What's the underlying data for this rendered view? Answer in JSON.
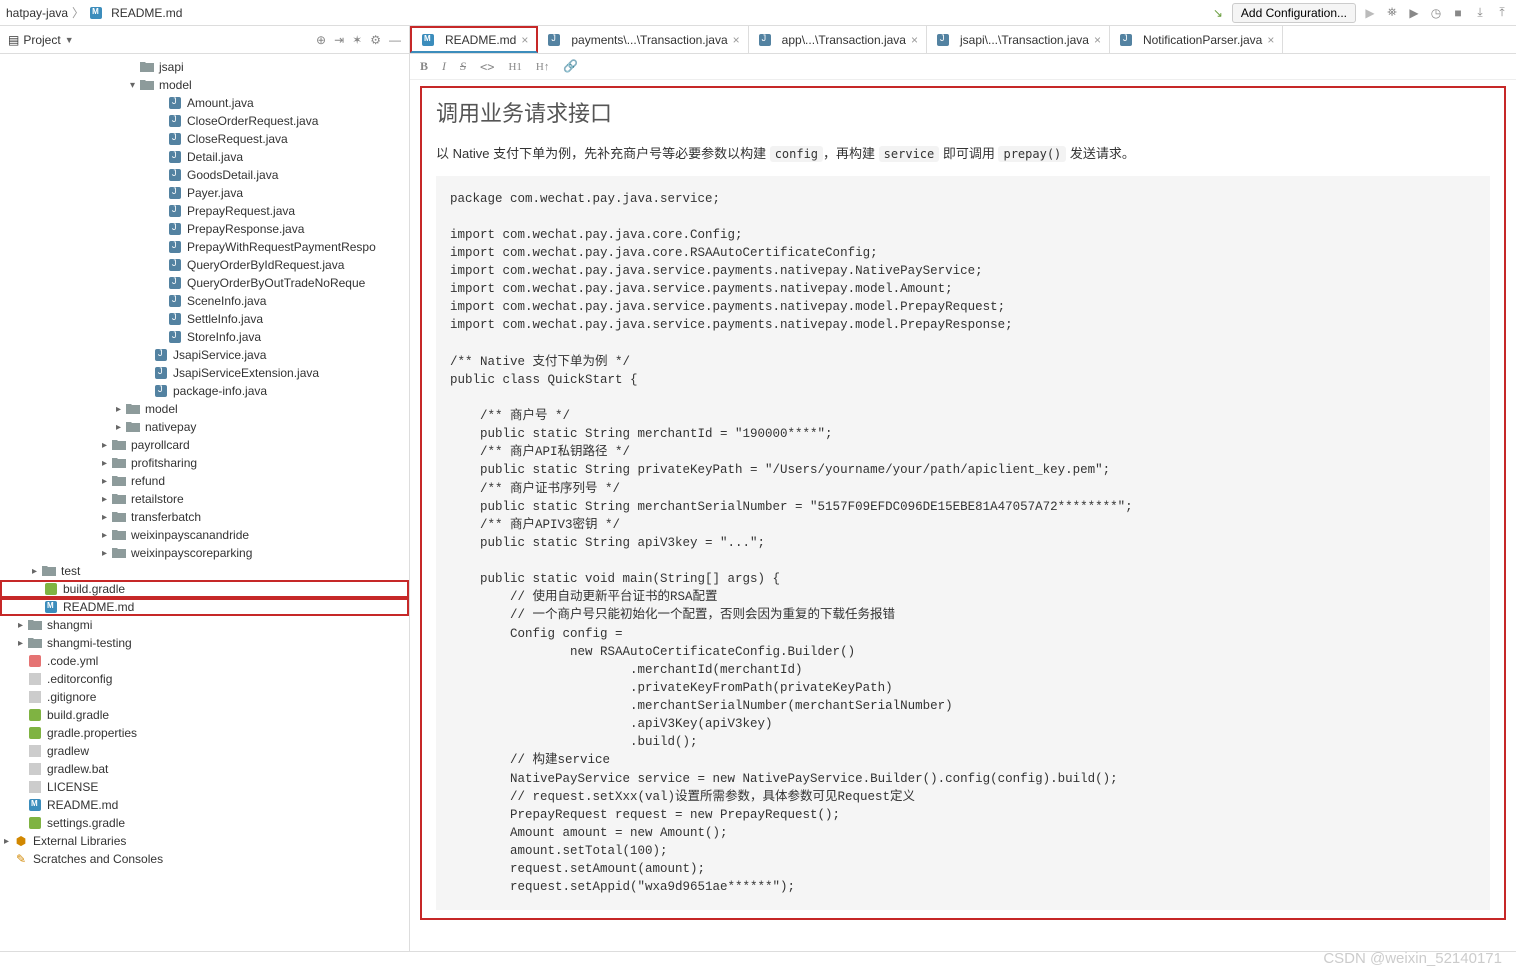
{
  "breadcrumb": {
    "items": [
      "hatpay-java",
      "README.md"
    ]
  },
  "top": {
    "config_btn": "Add Configuration..."
  },
  "sidebar": {
    "title": "Project"
  },
  "tree": {
    "jsapi": "jsapi",
    "model": "model",
    "files_model_inner": [
      "Amount.java",
      "CloseOrderRequest.java",
      "CloseRequest.java",
      "Detail.java",
      "GoodsDetail.java",
      "Payer.java",
      "PrepayRequest.java",
      "PrepayResponse.java",
      "PrepayWithRequestPaymentRespo",
      "QueryOrderByIdRequest.java",
      "QueryOrderByOutTradeNoReque",
      "SceneInfo.java",
      "SettleInfo.java",
      "StoreInfo.java"
    ],
    "jsapi_svc": "JsapiService.java",
    "jsapi_ext": "JsapiServiceExtension.java",
    "pkg_info": "package-info.java",
    "model_folder": "model",
    "nativepay": "nativepay",
    "payrollcard": "payrollcard",
    "profitsharing": "profitsharing",
    "refund": "refund",
    "retailstore": "retailstore",
    "transferbatch": "transferbatch",
    "weixinpayscanandride": "weixinpayscanandride",
    "weixinpayscoreparking": "weixinpayscoreparking",
    "test": "test",
    "build_gradle": "build.gradle",
    "readme": "README.md",
    "shangmi": "shangmi",
    "shangmi_testing": "shangmi-testing",
    "code_yml": ".code.yml",
    "editorconfig": ".editorconfig",
    "gitignore": ".gitignore",
    "build_gradle2": "build.gradle",
    "gradle_props": "gradle.properties",
    "gradlew": "gradlew",
    "gradlew_bat": "gradlew.bat",
    "license": "LICENSE",
    "readme2": "README.md",
    "settings": "settings.gradle",
    "ext_lib": "External Libraries",
    "scratches": "Scratches and Consoles"
  },
  "tabs": [
    {
      "label": "README.md",
      "close": "×",
      "active": true,
      "hl": true,
      "icon": "md"
    },
    {
      "label": "payments\\...\\Transaction.java",
      "close": "×",
      "active": false,
      "icon": "java"
    },
    {
      "label": "app\\...\\Transaction.java",
      "close": "×",
      "active": false,
      "icon": "java"
    },
    {
      "label": "jsapi\\...\\Transaction.java",
      "close": "×",
      "active": false,
      "icon": "java"
    },
    {
      "label": "NotificationParser.java",
      "close": "×",
      "active": false,
      "icon": "java"
    }
  ],
  "fmt": {
    "b": "B",
    "i": "I",
    "s": "S",
    "code": "<>",
    "h1": "H1",
    "h1u": "H↑",
    "link": "🔗"
  },
  "doc": {
    "title": "调用业务请求接口",
    "para_pre": "以 Native 支付下单为例，先补充商户号等必要参数以构建 ",
    "c1": "config",
    "para_mid": "，再构建 ",
    "c2": "service",
    "para_mid2": " 即可调用 ",
    "c3": "prepay()",
    "para_end": " 发送请求。",
    "code": "package com.wechat.pay.java.service;\n\nimport com.wechat.pay.java.core.Config;\nimport com.wechat.pay.java.core.RSAAutoCertificateConfig;\nimport com.wechat.pay.java.service.payments.nativepay.NativePayService;\nimport com.wechat.pay.java.service.payments.nativepay.model.Amount;\nimport com.wechat.pay.java.service.payments.nativepay.model.PrepayRequest;\nimport com.wechat.pay.java.service.payments.nativepay.model.PrepayResponse;\n\n/** Native 支付下单为例 */\npublic class QuickStart {\n\n    /** 商户号 */\n    public static String merchantId = \"190000****\";\n    /** 商户API私钥路径 */\n    public static String privateKeyPath = \"/Users/yourname/your/path/apiclient_key.pem\";\n    /** 商户证书序列号 */\n    public static String merchantSerialNumber = \"5157F09EFDC096DE15EBE81A47057A72********\";\n    /** 商户APIV3密钥 */\n    public static String apiV3key = \"...\";\n\n    public static void main(String[] args) {\n        // 使用自动更新平台证书的RSA配置\n        // 一个商户号只能初始化一个配置，否则会因为重复的下载任务报错\n        Config config =\n                new RSAAutoCertificateConfig.Builder()\n                        .merchantId(merchantId)\n                        .privateKeyFromPath(privateKeyPath)\n                        .merchantSerialNumber(merchantSerialNumber)\n                        .apiV3Key(apiV3key)\n                        .build();\n        // 构建service\n        NativePayService service = new NativePayService.Builder().config(config).build();\n        // request.setXxx(val)设置所需参数，具体参数可见Request定义\n        PrepayRequest request = new PrepayRequest();\n        Amount amount = new Amount();\n        amount.setTotal(100);\n        request.setAmount(amount);\n        request.setAppid(\"wxa9d9651ae******\");"
  },
  "watermark": "CSDN @weixin_52140171"
}
